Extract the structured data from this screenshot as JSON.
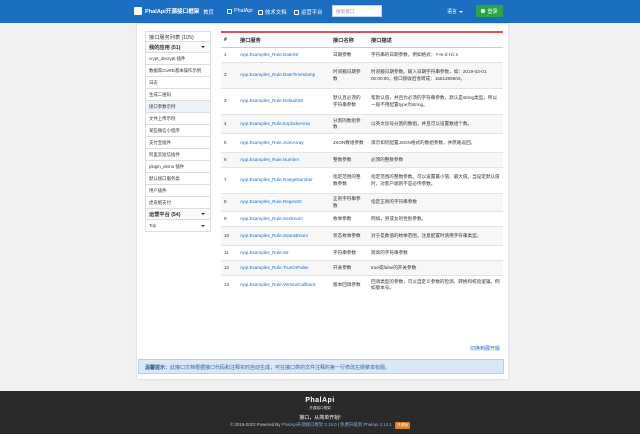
{
  "header": {
    "brand": "PhalApi开源接口框架",
    "nav": [
      {
        "label": "首页",
        "icon": "home-icon"
      },
      {
        "label": "PhalApi",
        "icon": "cube-icon"
      },
      {
        "label": "技术文档",
        "icon": "book-icon"
      },
      {
        "label": "运营平台",
        "icon": "chart-icon"
      }
    ],
    "search_placeholder": "搜索接口",
    "language": "语言",
    "login_label": "登录"
  },
  "sidebar": {
    "title": "接口服务列表 (105)",
    "group1": "我的应用 (51)",
    "items": [
      "crypt_decrypt 插件",
      "数据库CURD基本操作示例",
      "日志",
      "生成二维码",
      "接口参数示例",
      "文件上传示例",
      "某些微信小程序",
      "支付宝插件",
      "阿里云短信插件",
      "plugin_demo 插件",
      "默认接口服务类",
      "用户插件",
      "虎皮椒支付"
    ],
    "group2": "运营平台 (54)",
    "select_value": "Top"
  },
  "table": {
    "headers": [
      "#",
      "接口服务",
      "接口名称",
      "接口描述"
    ],
    "rows": [
      {
        "no": "1",
        "service": "App.Examples_Rule.DateStr",
        "name": "日期参数",
        "desc": "字符串的日期参数，例如格式：Y-m-d H:i:s"
      },
      {
        "no": "2",
        "service": "App.Examples_Rule.DateTimestamp",
        "name": "时间戳日期参数",
        "desc": "时间戳日期参数。输入日期字符串参数，如：2019-03-01 00:00:00，接口接收后会转成：1551369600。"
      },
      {
        "no": "3",
        "service": "App.Examples_Rule.DefaultStr",
        "name": "默认且必须的字符串参数",
        "desc": "帮默认值，并且为必须的字符串参数，默认是string类型，所以一般不用配置type为string。"
      },
      {
        "no": "4",
        "service": "App.Examples_Rule.ExplodeArray",
        "name": "分割的数组参数",
        "desc": "以英文逗号分割的数组，并且可以设置数组个数。"
      },
      {
        "no": "5",
        "service": "App.Examples_Rule.JsonArray",
        "name": "JSON数组参数",
        "desc": "演示如何配置JSON格式的数组参数，并原路返回。"
      },
      {
        "no": "6",
        "service": "App.Examples_Rule.Number",
        "name": "整数参数",
        "desc": "必须的整数参数"
      },
      {
        "no": "7",
        "service": "App.Examples_Rule.RangeNumber",
        "name": "指定范围的整数参数",
        "desc": "指定范围的整数参数。可以设置最小值、最大值。当设定默认值时，对客户端则不是必传参数。"
      },
      {
        "no": "8",
        "service": "App.Examples_Rule.RegexStr",
        "name": "正则字符串参数",
        "desc": "指定正则的字符串参数"
      },
      {
        "no": "9",
        "service": "App.Examples_Rule.SexEnum",
        "name": "枚举参数",
        "desc": "例如，男或女的性别参数。"
      },
      {
        "no": "10",
        "service": "App.Examples_Rule.StatusEnum",
        "name": "状态枚举参数",
        "desc": "对于是数值的枚举范围，注意配置时请用字符串类型。"
      },
      {
        "no": "11",
        "service": "App.Examples_Rule.Str",
        "name": "字符串参数",
        "desc": "简单的字符串参数"
      },
      {
        "no": "12",
        "service": "App.Examples_Rule.TrueOrFalse",
        "name": "开关参数",
        "desc": "true或false的开关参数"
      },
      {
        "no": "13",
        "service": "App.Examples_Rule.VersionCallback",
        "name": "版本回调参数",
        "desc": "回调类型的参数，可以自定义参数的检测、转换和校验逻辑。例如版本号。"
      }
    ]
  },
  "switch_link": "切换到展开版",
  "notice": {
    "label": "温馨提示：",
    "text": "此接口文档根据接口代码和注释实时自动生成，可在接口类的文件注释的第一行修改左侧菜单标题。"
  },
  "footer": {
    "logo": "PhalApi",
    "logo_sub": "开源接口框架",
    "slogan": "接口，从简单开始!",
    "copyright": "© 2015-2022 Powered By",
    "link1": "PhalApi开源接口框架 2.15.0",
    "sep": " | ",
    "link2": "免费升级到 PhalApi 2.14.1",
    "badge": "开源版"
  }
}
